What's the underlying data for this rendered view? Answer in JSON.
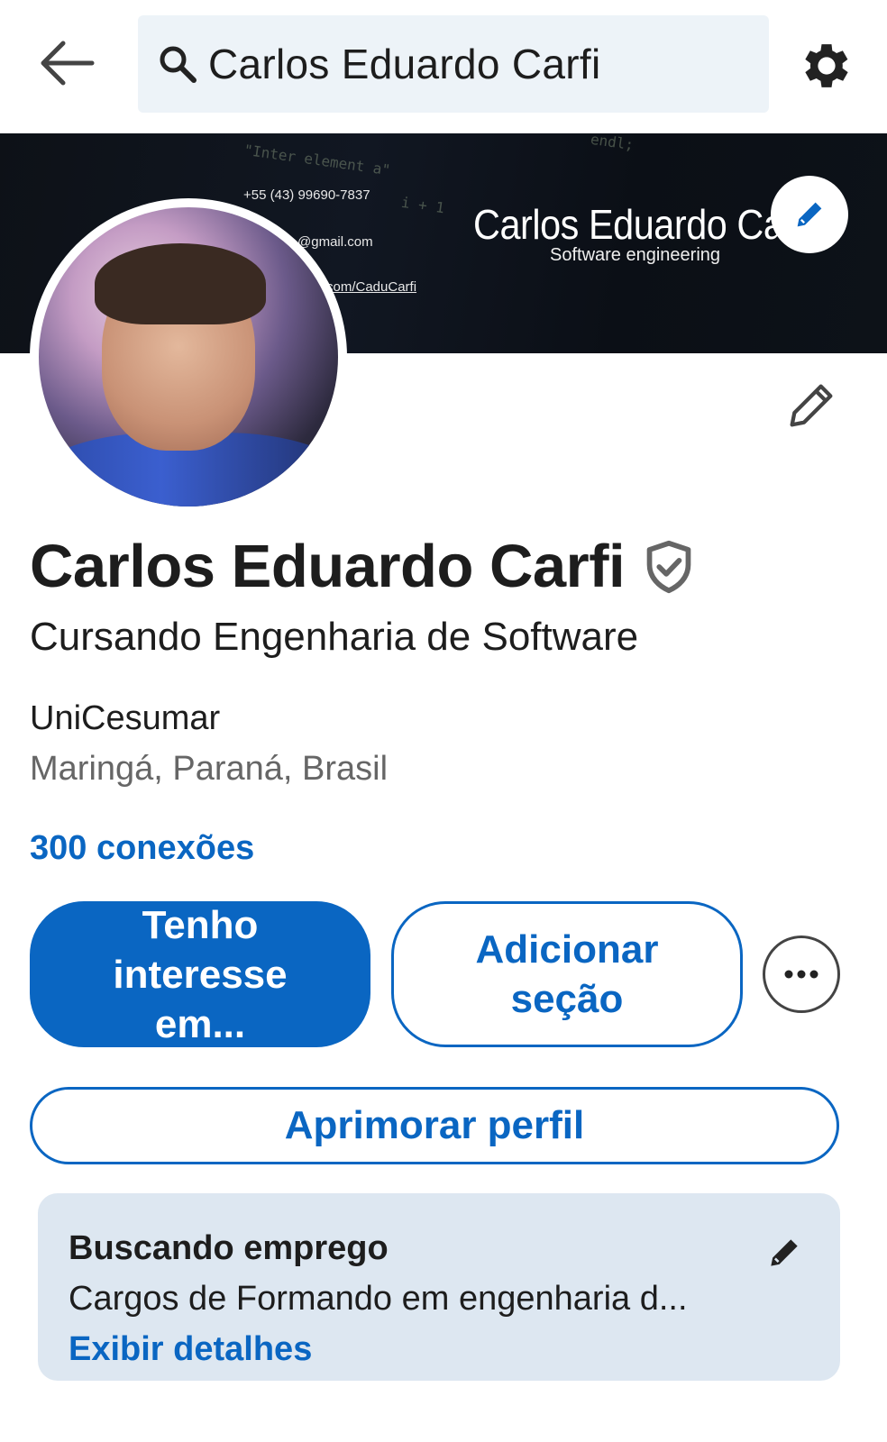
{
  "topbar": {
    "search_value": "Carlos Eduardo Carfi"
  },
  "banner": {
    "phone": "+55 (43) 99690-7837",
    "email_fragment": "@gmail.com",
    "link_fragment": "com/CaduCarfi",
    "name": "Carlos Eduardo Ca",
    "role": "Software engineering",
    "code_1": "\"Inter element a\"",
    "code_2": "endl;",
    "code_3": "i + 1"
  },
  "profile": {
    "name": "Carlos Eduardo Carfi",
    "headline": "Cursando Engenharia de Software",
    "school": "UniCesumar",
    "location": "Maringá, Paraná, Brasil",
    "connections": "300 conexões"
  },
  "actions": {
    "primary": "Tenho interesse em...",
    "secondary": "Adicionar seção",
    "more": "...",
    "improve": "Aprimorar perfil"
  },
  "open_to_work": {
    "title": "Buscando emprego",
    "description": "Cargos de Formando em engenharia d...",
    "link": "Exibir detalhes"
  },
  "colors": {
    "accent": "#0a66c2",
    "card_bg": "#dde7f1",
    "search_bg": "#edf3f8"
  }
}
